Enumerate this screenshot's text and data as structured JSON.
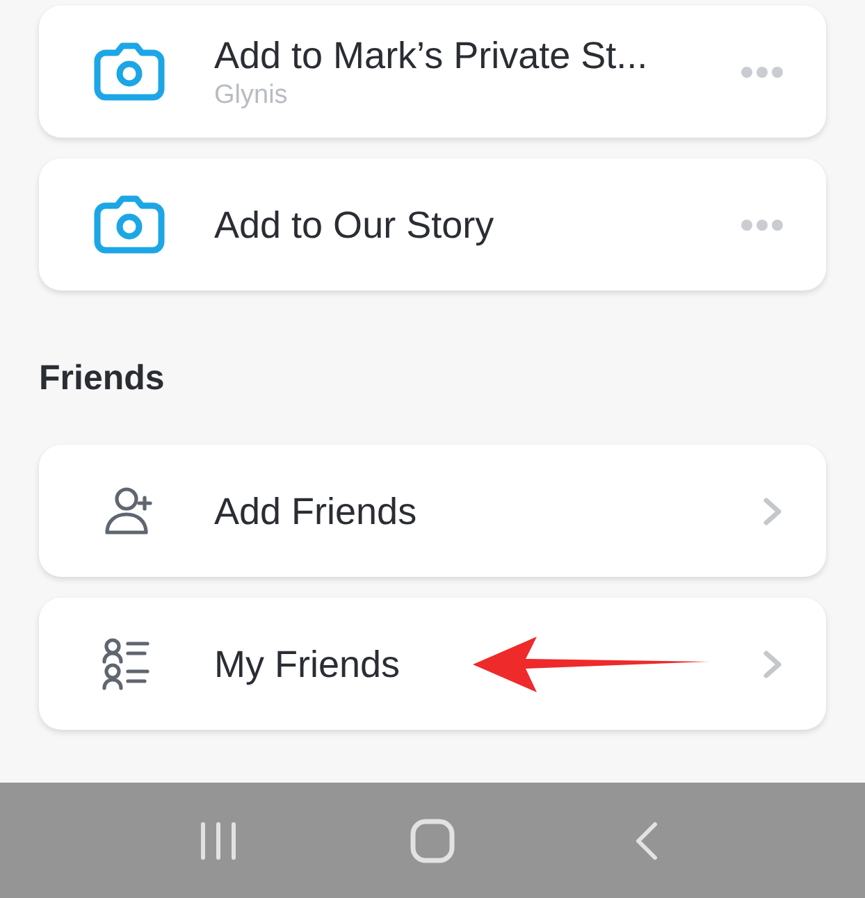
{
  "stories": [
    {
      "kind": "story",
      "title": "Add to Mark’s Private St...",
      "subtitle": "Glynis"
    },
    {
      "kind": "story",
      "title": "Add to Our Story"
    }
  ],
  "friends": {
    "heading": "Friends",
    "items": [
      {
        "kind": "add",
        "title": "Add Friends",
        "pointed": false
      },
      {
        "kind": "list",
        "title": "My Friends",
        "pointed": true
      }
    ]
  }
}
